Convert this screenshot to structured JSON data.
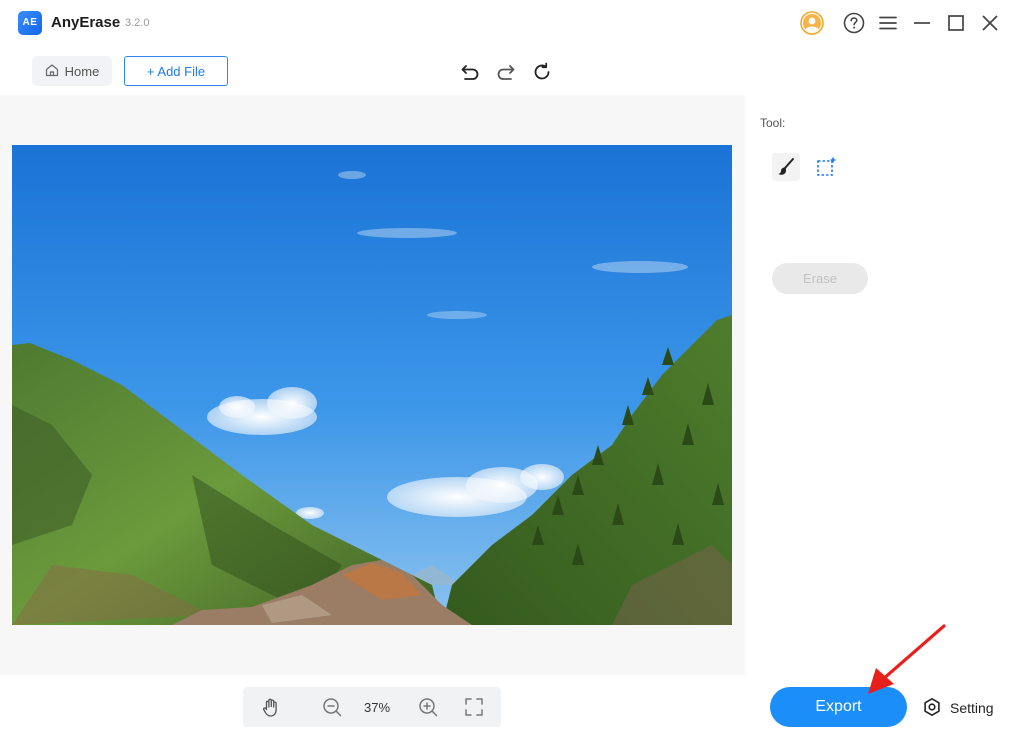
{
  "app": {
    "logo_text": "AE",
    "name": "AnyErase",
    "version": "3.2.0",
    "accent": "#1c8ef9"
  },
  "window_controls": [
    {
      "name": "account-icon"
    },
    {
      "name": "help-icon"
    },
    {
      "name": "menu-icon"
    },
    {
      "name": "minimize-icon"
    },
    {
      "name": "maximize-icon"
    },
    {
      "name": "close-icon"
    }
  ],
  "toolbar": {
    "home_label": "Home",
    "add_file_label": "+ Add File",
    "history_icons": [
      "undo-icon",
      "redo-icon",
      "reset-icon"
    ]
  },
  "canvas": {
    "image_subject": "mountain-valley-photo"
  },
  "panel": {
    "tool_label": "Tool:",
    "tools": [
      "brush-icon",
      "rectangle-select-icon"
    ],
    "erase_label": "Erase"
  },
  "bottom": {
    "zoom_icons": [
      "hand-icon",
      "zoom-out-icon",
      "zoom-in-icon",
      "fit-screen-icon"
    ],
    "zoom_level": "37%",
    "export_label": "Export",
    "setting_label": "Setting"
  }
}
